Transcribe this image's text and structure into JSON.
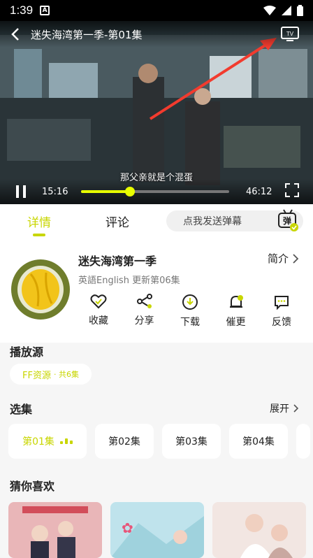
{
  "status": {
    "time": "1:39",
    "notif_icon": "A"
  },
  "player": {
    "title": "迷失海湾第一季-第01集",
    "subtitle": "那父亲就是个混蛋",
    "current_time": "15:16",
    "total_time": "46:12",
    "progress": 0.33,
    "accent": "#e8ff00"
  },
  "tabs": {
    "details": "详情",
    "comments": "评论",
    "danmu_placeholder": "点我发送弹幕",
    "danmu_badge": "弹"
  },
  "show": {
    "title": "迷失海湾第一季",
    "intro": "简介",
    "meta": "英語English 更新第06集",
    "actions": [
      "收藏",
      "分享",
      "下载",
      "催更",
      "反馈"
    ]
  },
  "sources": {
    "heading": "播放源",
    "name": "FF资源",
    "count": "· 共6集"
  },
  "episodes": {
    "heading": "选集",
    "expand": "展开",
    "items": [
      "第01集",
      "第02集",
      "第03集",
      "第04集"
    ]
  },
  "recommend": {
    "heading": "猜你喜欢"
  }
}
